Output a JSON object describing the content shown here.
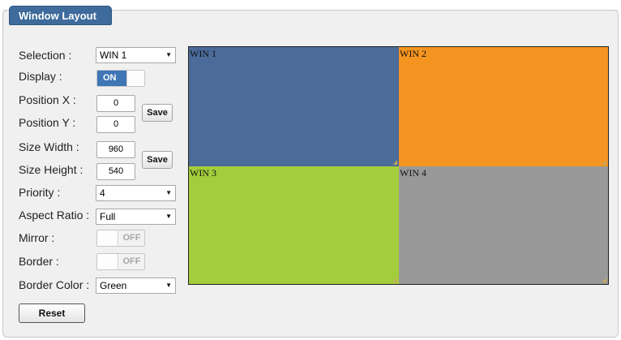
{
  "panel": {
    "title": "Window Layout"
  },
  "form": {
    "selection": {
      "label": "Selection :",
      "value": "WIN 1"
    },
    "display": {
      "label": "Display :",
      "state": "ON"
    },
    "position_x": {
      "label": "Position X :",
      "value": "0"
    },
    "position_y": {
      "label": "Position Y :",
      "value": "0"
    },
    "position_save": "Save",
    "size_width": {
      "label": "Size Width :",
      "value": "960"
    },
    "size_height": {
      "label": "Size Height :",
      "value": "540"
    },
    "size_save": "Save",
    "priority": {
      "label": "Priority :",
      "value": "4"
    },
    "aspect_ratio": {
      "label": "Aspect Ratio :",
      "value": "Full"
    },
    "mirror": {
      "label": "Mirror :",
      "state": "OFF"
    },
    "border": {
      "label": "Border :",
      "state": "OFF"
    },
    "border_color": {
      "label": "Border Color :",
      "value": "Green"
    },
    "reset": "Reset"
  },
  "layout_preview": {
    "windows": [
      {
        "label": "WIN 1",
        "color": "#4b6b99"
      },
      {
        "label": "WIN 2",
        "color": "#f39520"
      },
      {
        "label": "WIN 3",
        "color": "#a3cd3c"
      },
      {
        "label": "WIN 4",
        "color": "#999999"
      }
    ]
  },
  "icons": {
    "dropdown": "chevron-down-icon",
    "resize": "resize-grip-icon"
  }
}
